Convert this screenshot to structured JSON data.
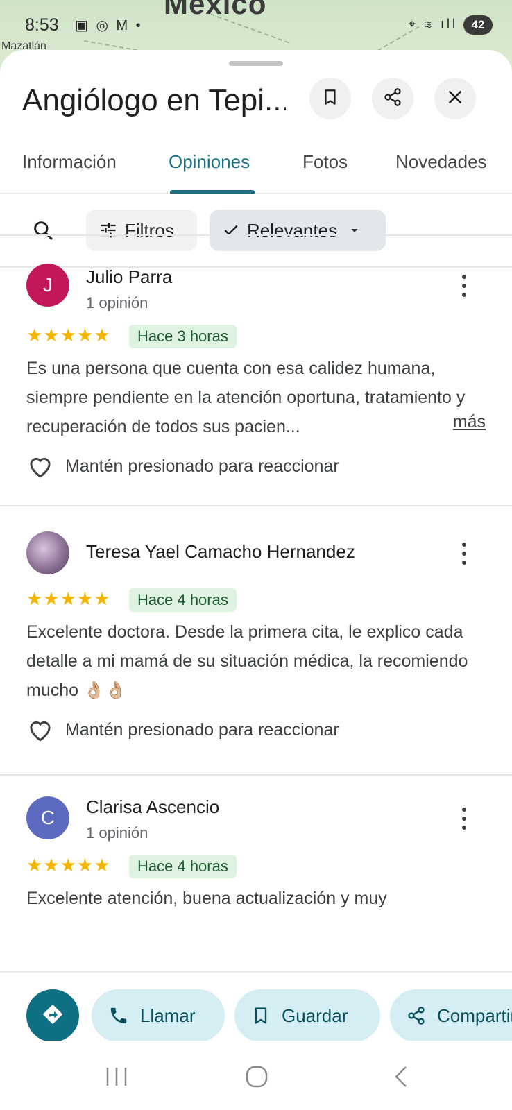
{
  "map": {
    "country": "México",
    "city": "Mazatlán"
  },
  "status_bar": {
    "time": "8:53",
    "battery": "42"
  },
  "header": {
    "title": "Angiólogo en Tepi...",
    "bookmark_icon": "bookmark-icon",
    "share_icon": "share-icon",
    "close_icon": "close-icon"
  },
  "tabs": [
    {
      "label": "Información",
      "active": false
    },
    {
      "label": "Opiniones",
      "active": true
    },
    {
      "label": "Fotos",
      "active": false
    },
    {
      "label": "Novedades",
      "active": false
    }
  ],
  "filters": {
    "search_icon": "search-icon",
    "filtros_label": "Filtros",
    "relevantes_label": "Relevantes"
  },
  "reviews": [
    {
      "avatar_letter": "J",
      "avatar_color": "#c2185b",
      "name": "Julio Parra",
      "count": "1 opinión",
      "stars": "★★★★★",
      "rating": 5,
      "time": "Hace 3 horas",
      "text": "Es una persona que cuenta con esa calidez humana, siempre pendiente en la atención oportuna, tratamiento y recuperación de todos sus pacien...",
      "more": "más",
      "react_label": "Mantén presionado para reaccionar"
    },
    {
      "avatar_letter": "",
      "avatar_color": "#7e5a8a",
      "name": "Teresa Yael Camacho Hernandez",
      "count": "",
      "stars": "★★★★★",
      "rating": 5,
      "time": "Hace 4 horas",
      "text": "Excelente doctora. Desde la primera cita, le explico cada detalle a mi mamá de su situación médica, la recomiendo mucho 👌🏼👌🏼",
      "more": "",
      "react_label": "Mantén presionado para reaccionar"
    },
    {
      "avatar_letter": "C",
      "avatar_color": "#5c6bc0",
      "name": "Clarisa Ascencio",
      "count": "1 opinión",
      "stars": "★★★★★",
      "rating": 5,
      "time": "Hace 4 horas",
      "text": "Excelente atención, buena actualización y muy",
      "more": "",
      "react_label": ""
    }
  ],
  "actions": {
    "directions_icon": "directions-icon",
    "call_label": "Llamar",
    "save_label": "Guardar",
    "share_label": "Compartir"
  },
  "colors": {
    "accent": "#1a7385",
    "star": "#f4b400",
    "time_badge_bg": "#dff3e3",
    "pill_bg": "#d4eef4"
  }
}
